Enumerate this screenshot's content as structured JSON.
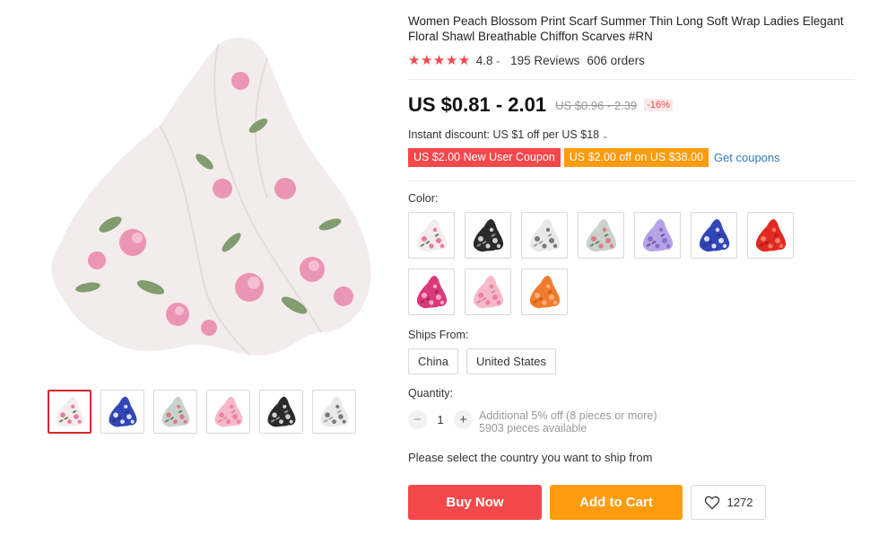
{
  "product": {
    "title": "Women Peach Blossom Print Scarf Summer Thin Long Soft Wrap Ladies Elegant Floral Shawl Breathable Chiffon Scarves #RN",
    "stars": "★★★★★",
    "rating": "4.8",
    "reviews": "195 Reviews",
    "orders": "606 orders"
  },
  "price": {
    "current": "US $0.81 - 2.01",
    "original": "US $0.96 - 2.39",
    "discount": "-16%"
  },
  "promo": {
    "instant_discount": "Instant discount: US $1 off per US $18",
    "coupons": [
      {
        "label": "US $2.00 New User Coupon",
        "color": "#f4484b"
      },
      {
        "label": "US $2.00 off on US $38.00",
        "color": "#ff9b0f"
      }
    ],
    "get_coupons": "Get coupons"
  },
  "color": {
    "label": "Color:",
    "swatches": [
      {
        "name": "pink-white",
        "base": "#f4ecec",
        "flower": "#e87aa0",
        "leaf": "#6e8f5a"
      },
      {
        "name": "black",
        "base": "#2a2a2a",
        "flower": "#cfcfcf",
        "leaf": "#8a8a8a"
      },
      {
        "name": "gray-white",
        "base": "#e9e9e9",
        "flower": "#7a7a7a",
        "leaf": "#a8a8a8"
      },
      {
        "name": "gray-green",
        "base": "#c9d2cc",
        "flower": "#e07a8a",
        "leaf": "#6f8a70"
      },
      {
        "name": "purple",
        "base": "#b7a3e6",
        "flower": "#8a6fd0",
        "leaf": "#6a5b9c"
      },
      {
        "name": "blue",
        "base": "#3146b8",
        "flower": "#e0e0ff",
        "leaf": "#2a3580"
      },
      {
        "name": "red",
        "base": "#e02a22",
        "flower": "#ff7a6a",
        "leaf": "#a81e18"
      },
      {
        "name": "rose",
        "base": "#d93a7a",
        "flower": "#f7a6c6",
        "leaf": "#9a2a58"
      },
      {
        "name": "light-pink",
        "base": "#f5b9c8",
        "flower": "#ef7fa0",
        "leaf": "#d98aa0"
      },
      {
        "name": "orange",
        "base": "#f07a2e",
        "flower": "#ffb07a",
        "leaf": "#c85a18"
      }
    ]
  },
  "shipping": {
    "label": "Ships From:",
    "options": [
      "China",
      "United States"
    ],
    "message": "Please select the country you want to ship from"
  },
  "quantity": {
    "label": "Quantity:",
    "minus": "−",
    "plus": "+",
    "value": "1",
    "note_line1": "Additional 5% off (8 pieces or more)",
    "note_line2": "5903 pieces available"
  },
  "actions": {
    "buy_now": "Buy Now",
    "add_to_cart": "Add to Cart",
    "wishlist_count": "1272"
  },
  "gallery": {
    "thumbs": [
      {
        "name": "pink-white",
        "base": "#f4ecec",
        "flower": "#e87aa0",
        "leaf": "#6e8f5a",
        "active": true
      },
      {
        "name": "blue",
        "base": "#3146b8",
        "flower": "#e0e0ff",
        "leaf": "#2a3580"
      },
      {
        "name": "gray-green",
        "base": "#c9d2cc",
        "flower": "#e07a8a",
        "leaf": "#6f8a70"
      },
      {
        "name": "light-pink",
        "base": "#f5b9c8",
        "flower": "#ef7fa0",
        "leaf": "#d98aa0"
      },
      {
        "name": "black",
        "base": "#2a2a2a",
        "flower": "#cfcfcf",
        "leaf": "#8a8a8a"
      },
      {
        "name": "gray-white",
        "base": "#e9e9e9",
        "flower": "#7a7a7a",
        "leaf": "#a8a8a8"
      }
    ]
  }
}
